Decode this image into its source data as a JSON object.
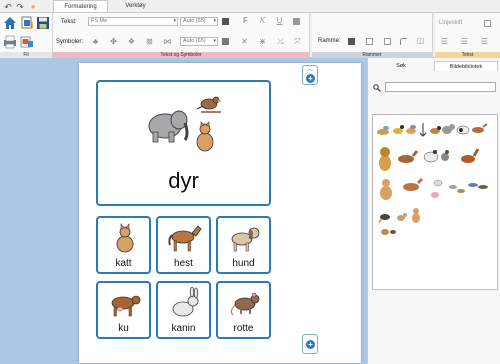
{
  "quick_access": {
    "undo": "↶",
    "redo": "↷",
    "new": "●"
  },
  "tabs": [
    {
      "label": "Formatering",
      "active": true
    },
    {
      "label": "Verktøy",
      "active": false
    }
  ],
  "groups": {
    "fil": "Fil",
    "tekst_og_symboler": "Tekst og Symboler",
    "rammer": "Rammer",
    "tekst": "Tekst"
  },
  "text_format": {
    "tekst_label": "Tekst:",
    "font_value": "FS Me",
    "font_size_value": "Auto (65)",
    "bold": "F",
    "italic": "K",
    "underline": "U"
  },
  "symbol_format": {
    "symboler_label": "Symboler:",
    "size_value": "Auto (65)"
  },
  "frame": {
    "ramme_label": "Ramme:"
  },
  "text_group": {
    "linjeskift": "Linjeskift"
  },
  "panel": {
    "tabs": [
      {
        "label": "Søk",
        "active": true
      },
      {
        "label": "Bildebibliotek",
        "active": false
      }
    ],
    "search": {
      "placeholder": "",
      "value": ""
    }
  },
  "page": {
    "main_card": {
      "label": "dyr"
    },
    "cards": [
      {
        "label": "katt"
      },
      {
        "label": "hest"
      },
      {
        "label": "hund"
      },
      {
        "label": "ku"
      },
      {
        "label": "kanin"
      },
      {
        "label": "rotte"
      }
    ]
  },
  "colors": {
    "card_border": "#2e7ab8",
    "ribbon_text_group_band": "#f2b9c4",
    "ribbon_rammer_band": "#ccd3da",
    "ribbon_tekst_band": "#f4d69a",
    "workspace_bg": "#aac7e4"
  }
}
